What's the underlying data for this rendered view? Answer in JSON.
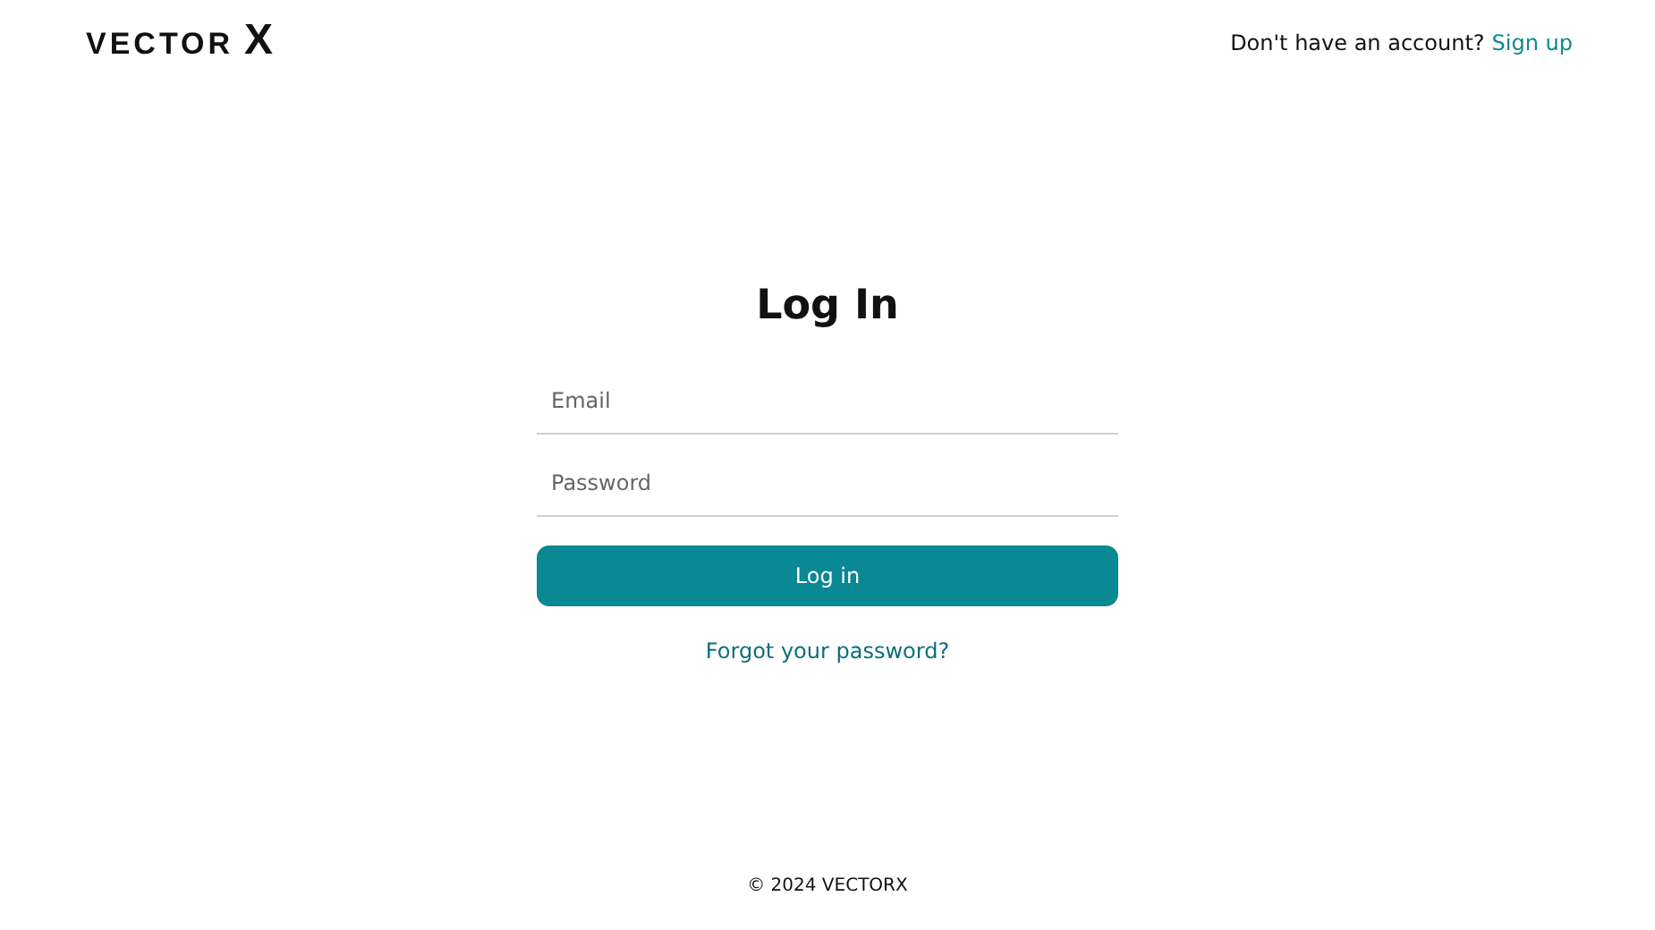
{
  "header": {
    "logo": {
      "word": "VECTOR",
      "mark": "X"
    },
    "prompt": "Don't have an account?",
    "signup_link": "Sign up"
  },
  "form": {
    "title": "Log In",
    "fields": [
      {
        "placeholder": "Email"
      },
      {
        "placeholder": "Password"
      }
    ],
    "submit": "Log in",
    "forgot_link": "Forgot your password?"
  },
  "footer": "© 2024 VECTORX"
}
